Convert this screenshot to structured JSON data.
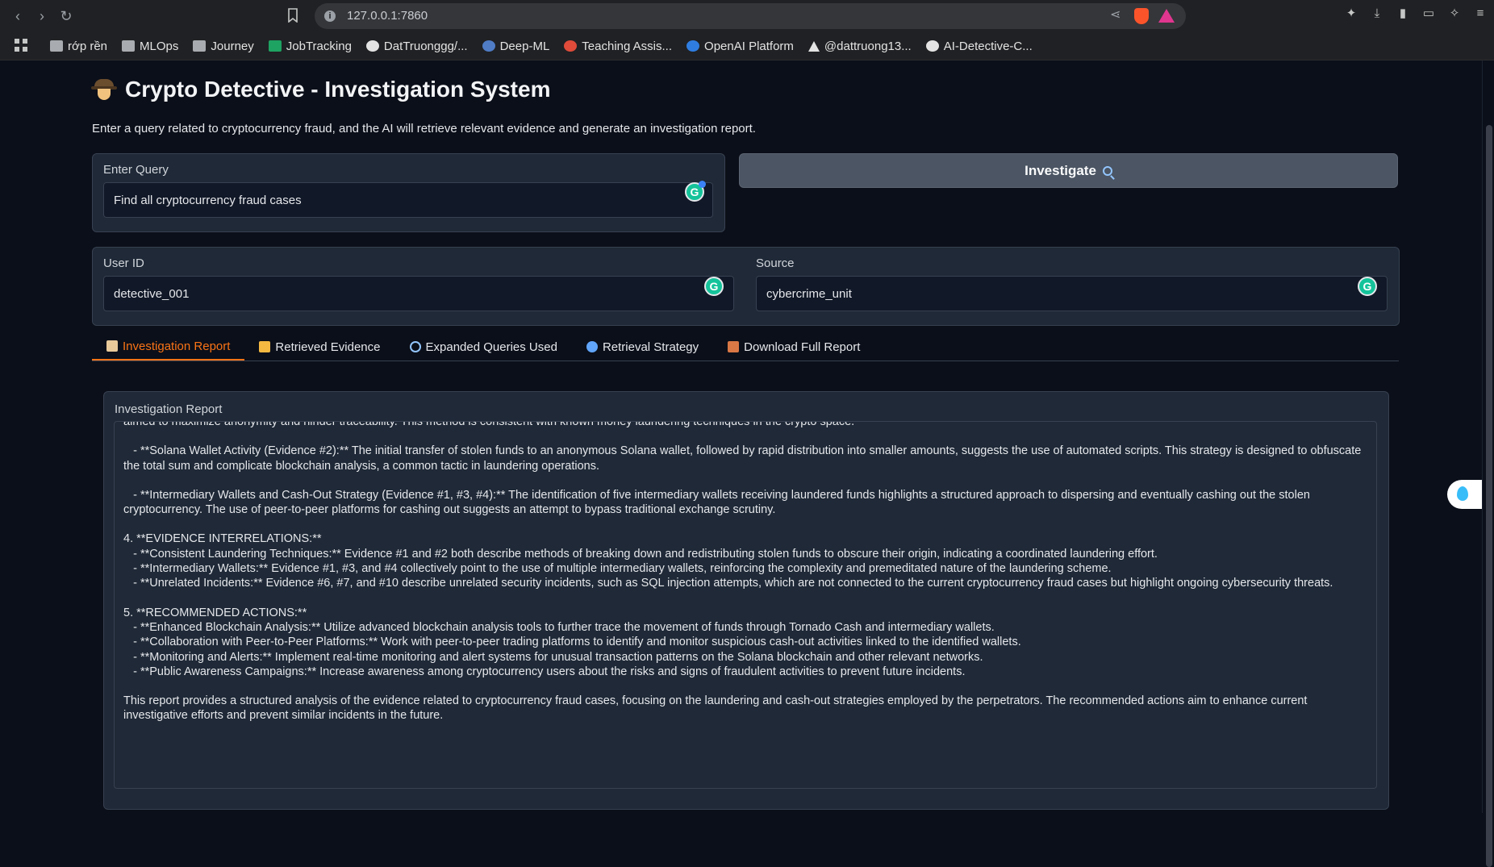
{
  "browser": {
    "url": "127.0.0.1:7860",
    "bookmarks": [
      {
        "label": "rớp rền",
        "icon": "folder-icon"
      },
      {
        "label": "MLOps",
        "icon": "folder-icon"
      },
      {
        "label": "Journey",
        "icon": "folder-icon"
      },
      {
        "label": "JobTracking",
        "icon": "sheets-icon"
      },
      {
        "label": "DatTruonggg/...",
        "icon": "github-icon"
      },
      {
        "label": "Deep-ML",
        "icon": "deepml-icon"
      },
      {
        "label": "Teaching Assis...",
        "icon": "red-circle-icon"
      },
      {
        "label": "OpenAI Platform",
        "icon": "openai-icon"
      },
      {
        "label": "@dattruong13...",
        "icon": "x-icon"
      },
      {
        "label": "AI-Detective-C...",
        "icon": "github-icon"
      }
    ]
  },
  "app": {
    "title": "Crypto Detective - Investigation System",
    "subtitle": "Enter a query related to cryptocurrency fraud, and the AI will retrieve relevant evidence and generate an investigation report.",
    "query": {
      "label": "Enter Query",
      "value": "Find all cryptocurrency fraud cases"
    },
    "investigate_button": "Investigate",
    "user_id": {
      "label": "User ID",
      "value": "detective_001"
    },
    "source": {
      "label": "Source",
      "value": "cybercrime_unit"
    },
    "tabs": [
      {
        "label": "Investigation Report",
        "icon": "scroll-icon",
        "active": true
      },
      {
        "label": "Retrieved Evidence",
        "icon": "open-folder-icon",
        "active": false
      },
      {
        "label": "Expanded Queries Used",
        "icon": "search-icon",
        "active": false
      },
      {
        "label": "Retrieval Strategy",
        "icon": "gear-icon",
        "active": false
      },
      {
        "label": "Download Full Report",
        "icon": "inbox-icon",
        "active": false
      }
    ],
    "report": {
      "label": "Investigation Report",
      "lines": [
        "aimed to maximize anonymity and hinder traceability. This method is consistent with known money laundering techniques in the crypto space.",
        "",
        "   - **Solana Wallet Activity (Evidence #2):** The initial transfer of stolen funds to an anonymous Solana wallet, followed by rapid distribution into smaller amounts, suggests the use of automated scripts. This strategy is designed to obfuscate the total sum and complicate blockchain analysis, a common tactic in laundering operations.",
        "",
        "   - **Intermediary Wallets and Cash-Out Strategy (Evidence #1, #3, #4):** The identification of five intermediary wallets receiving laundered funds highlights a structured approach to dispersing and eventually cashing out the stolen cryptocurrency. The use of peer-to-peer platforms for cashing out suggests an attempt to bypass traditional exchange scrutiny.",
        "",
        "4. **EVIDENCE INTERRELATIONS:**",
        "   - **Consistent Laundering Techniques:** Evidence #1 and #2 both describe methods of breaking down and redistributing stolen funds to obscure their origin, indicating a coordinated laundering effort.",
        "   - **Intermediary Wallets:** Evidence #1, #3, and #4 collectively point to the use of multiple intermediary wallets, reinforcing the complexity and premeditated nature of the laundering scheme.",
        "   - **Unrelated Incidents:** Evidence #6, #7, and #10 describe unrelated security incidents, such as SQL injection attempts, which are not connected to the current cryptocurrency fraud cases but highlight ongoing cybersecurity threats.",
        "",
        "5. **RECOMMENDED ACTIONS:**",
        "   - **Enhanced Blockchain Analysis:** Utilize advanced blockchain analysis tools to further trace the movement of funds through Tornado Cash and intermediary wallets.",
        "   - **Collaboration with Peer-to-Peer Platforms:** Work with peer-to-peer trading platforms to identify and monitor suspicious cash-out activities linked to the identified wallets.",
        "   - **Monitoring and Alerts:** Implement real-time monitoring and alert systems for unusual transaction patterns on the Solana blockchain and other relevant networks.",
        "   - **Public Awareness Campaigns:** Increase awareness among cryptocurrency users about the risks and signs of fraudulent activities to prevent future incidents.",
        "",
        "This report provides a structured analysis of the evidence related to cryptocurrency fraud cases, focusing on the laundering and cash-out strategies employed by the perpetrators. The recommended actions aim to enhance current investigative efforts and prevent similar incidents in the future."
      ]
    }
  }
}
